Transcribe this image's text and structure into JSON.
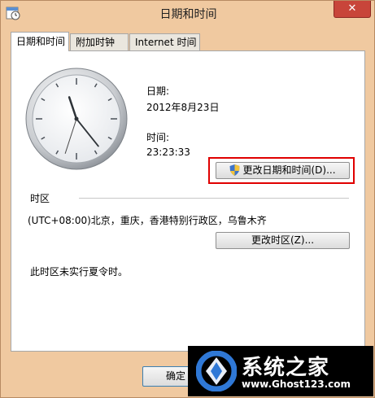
{
  "window": {
    "title": "日期和时间",
    "close_glyph": "✕"
  },
  "tabs": [
    {
      "label": "日期和时间",
      "active": true
    },
    {
      "label": "附加时钟",
      "active": false
    },
    {
      "label": "Internet 时间",
      "active": false
    }
  ],
  "clock": {
    "time": "23:23:33"
  },
  "date_section": {
    "date_label": "日期:",
    "date_value": "2012年8月23日",
    "time_label": "时间:",
    "time_value": "23:23:33"
  },
  "change_datetime_button": {
    "label": "更改日期和时间(D)...",
    "icon": "uac-shield-icon"
  },
  "timezone": {
    "header": "时区",
    "value": "(UTC+08:00)北京，重庆，香港特别行政区，乌鲁木齐",
    "change_button": "更改时区(Z)...",
    "dst_note": "此时区未实行夏令时。"
  },
  "ok_button": "确定",
  "watermark": {
    "name": "系统之家",
    "url": "www.Ghost123.com"
  },
  "colors": {
    "highlight": "#e00000",
    "close_button": "#c8453a",
    "frame": "#f0c9a0"
  }
}
